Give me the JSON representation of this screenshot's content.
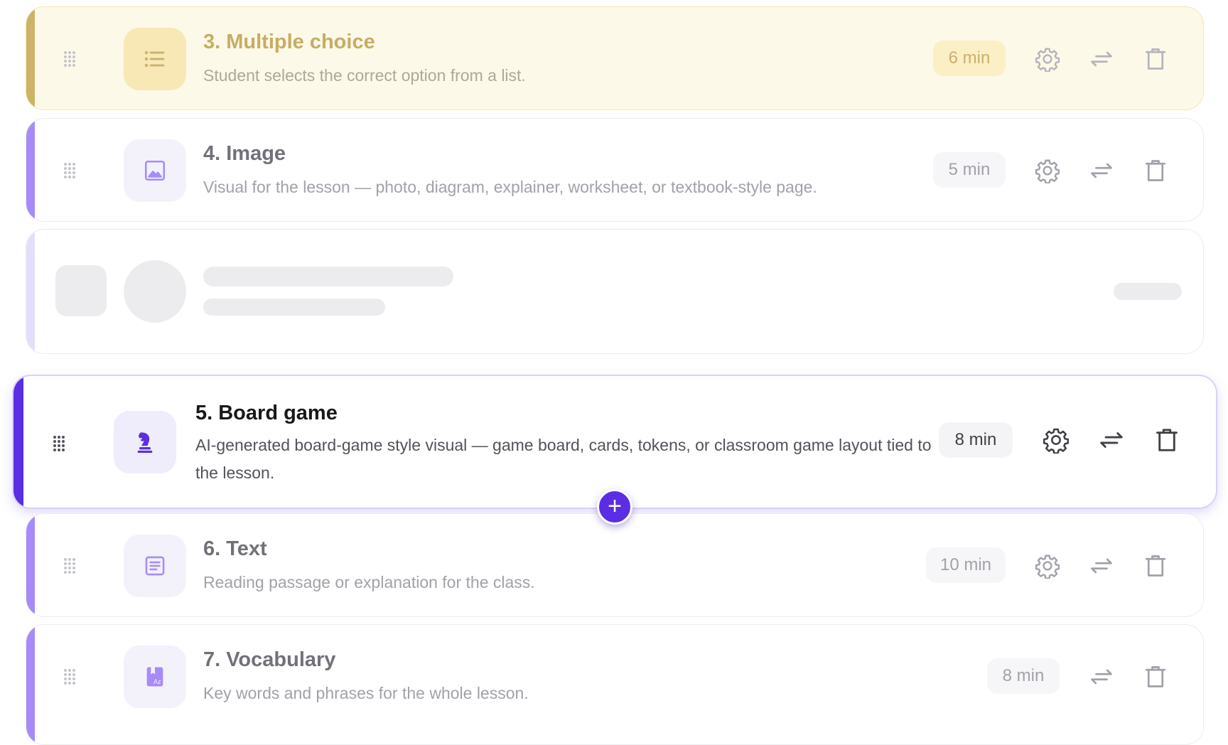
{
  "add_label": "+",
  "blocks": [
    {
      "title": "3. Multiple choice",
      "description": "Student selects the correct option from a list.",
      "duration": "6 min",
      "icon": "list-icon",
      "has_settings": true
    },
    {
      "title": "4. Image",
      "description": "Visual for the lesson — photo, diagram, explainer, worksheet, or textbook-style page.",
      "duration": "5 min",
      "icon": "image-icon",
      "has_settings": true
    },
    {
      "title": "5. Board game",
      "description": "AI-generated board-game style visual — game board, cards, tokens, or classroom game layout tied to the lesson.",
      "duration": "8 min",
      "icon": "chess-knight-icon",
      "has_settings": true
    },
    {
      "title": "6. Text",
      "description": "Reading passage or explanation for the class.",
      "duration": "10 min",
      "icon": "document-icon",
      "has_settings": true
    },
    {
      "title": "7. Vocabulary",
      "description": "Key words and phrases for the whole lesson.",
      "duration": "8 min",
      "icon": "dictionary-icon",
      "has_settings": false
    }
  ],
  "colors": {
    "accent": "#5b2de3",
    "block_bar": "#a78bfa",
    "multiple_choice_bg": "#fdf9e9",
    "multiple_choice_accent": "#c7ad63"
  }
}
